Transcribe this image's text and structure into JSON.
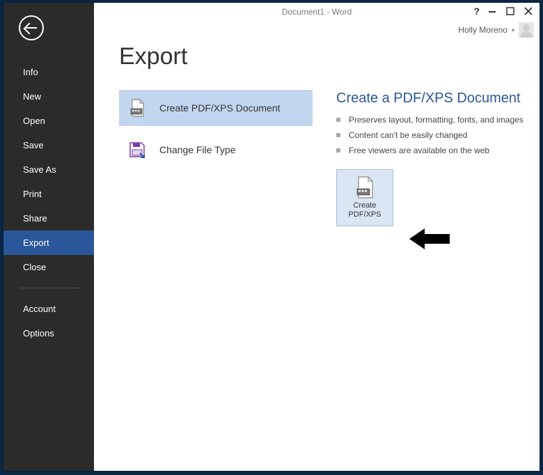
{
  "window": {
    "title": "Document1 - Word"
  },
  "user": {
    "name": "Holly Moreno"
  },
  "sidebar": {
    "items": [
      "Info",
      "New",
      "Open",
      "Save",
      "Save As",
      "Print",
      "Share",
      "Export",
      "Close"
    ],
    "footer_items": [
      "Account",
      "Options"
    ],
    "selected_index": 7
  },
  "page": {
    "title": "Export"
  },
  "export_options": [
    {
      "label": "Create PDF/XPS Document",
      "icon": "pdf-doc",
      "selected": true
    },
    {
      "label": "Change File Type",
      "icon": "diskette",
      "selected": false
    }
  ],
  "detail": {
    "title": "Create a PDF/XPS Document",
    "bullets": [
      "Preserves layout, formatting, fonts, and images",
      "Content can't be easily changed",
      "Free viewers are available on the web"
    ],
    "button_label_line1": "Create",
    "button_label_line2": "PDF/XPS"
  }
}
